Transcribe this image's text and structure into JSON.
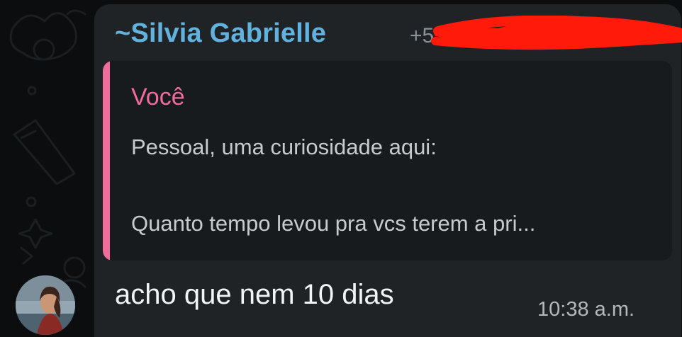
{
  "message": {
    "sender_prefix": "~",
    "sender_name": "Silvia Gabrielle",
    "sender_phone_visible": "+55",
    "sender_phone_redacted": true,
    "text": "acho que nem 10 dias",
    "time": "10:38 a.m."
  },
  "reply_quote": {
    "author": "Você",
    "line1": "Pessoal, uma curiosidade aqui:",
    "line2": "Quanto tempo levou pra vcs terem a pri..."
  },
  "colors": {
    "sender_name": "#61b3de",
    "quote_accent": "#f06c9b",
    "redaction": "#ff1a0a",
    "bubble": "#1f2326",
    "background": "#0b0d0e"
  },
  "icons": {
    "avatar": "user-avatar-photo",
    "redaction": "red-scribble-redaction"
  }
}
